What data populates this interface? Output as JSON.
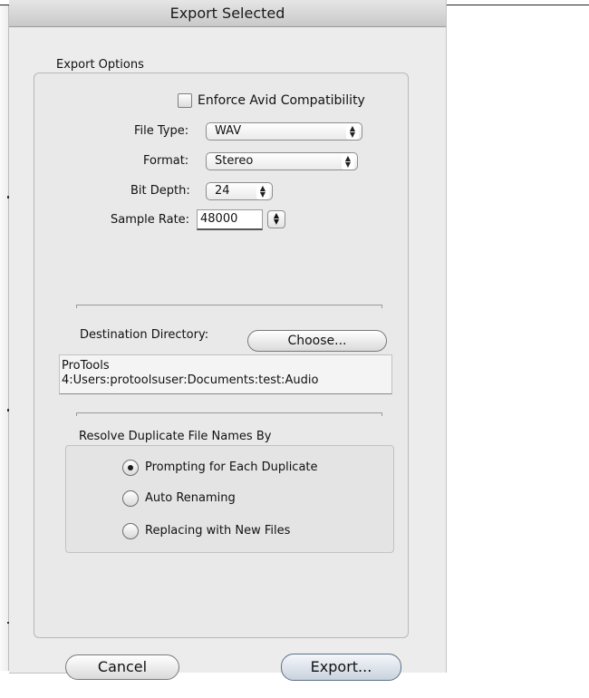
{
  "window": {
    "title": "Export Selected"
  },
  "export_options": {
    "group_label": "Export Options",
    "enforce_avid": {
      "label": "Enforce Avid Compatibility",
      "checked": false
    },
    "file_type": {
      "label": "File Type:",
      "value": "WAV"
    },
    "format": {
      "label": "Format:",
      "value": "Stereo"
    },
    "bit_depth": {
      "label": "Bit Depth:",
      "value": "24"
    },
    "sample_rate": {
      "label": "Sample Rate:",
      "value": "48000"
    }
  },
  "destination": {
    "label": "Destination Directory:",
    "choose_button": "Choose...",
    "path": "ProTools\n4:Users:protoolsuser:Documents:test:Audio"
  },
  "duplicates": {
    "label": "Resolve Duplicate File Names By",
    "options": [
      {
        "label": "Prompting for Each Duplicate",
        "selected": true
      },
      {
        "label": "Auto Renaming",
        "selected": false
      },
      {
        "label": "Replacing with New Files",
        "selected": false
      }
    ]
  },
  "buttons": {
    "cancel": "Cancel",
    "export": "Export..."
  },
  "icons": {
    "popup_arrows": "up-down-arrows-icon",
    "stepper": "stepper-arrows-icon"
  }
}
